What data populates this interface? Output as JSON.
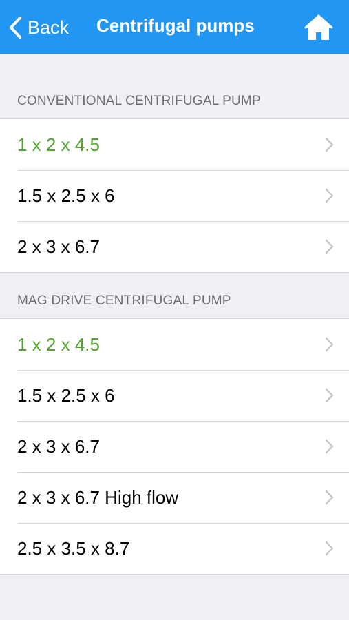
{
  "header": {
    "back_label": "Back",
    "title": "Centrifugal pumps",
    "home_icon": "home-icon",
    "back_icon": "chevron-left-icon",
    "background_color": "#2196f3"
  },
  "sections": [
    {
      "title": "CONVENTIONAL CENTRIFUGAL PUMP",
      "items": [
        {
          "label": "1 x 2 x 4.5",
          "highlighted": true
        },
        {
          "label": "1.5 x 2.5 x 6",
          "highlighted": false
        },
        {
          "label": "2 x 3 x 6.7",
          "highlighted": false
        }
      ]
    },
    {
      "title": "MAG DRIVE CENTRIFUGAL PUMP",
      "items": [
        {
          "label": "1 x 2 x 4.5",
          "highlighted": true
        },
        {
          "label": "1.5 x 2.5 x 6",
          "highlighted": false
        },
        {
          "label": "2 x 3 x 6.7",
          "highlighted": false
        },
        {
          "label": "2 x 3 x 6.7 High flow",
          "highlighted": false
        },
        {
          "label": "2.5 x 3.5 x 8.7",
          "highlighted": false
        }
      ]
    }
  ],
  "colors": {
    "highlight_text": "#55a630",
    "section_header_text": "#6d6d72",
    "page_background": "#efeff4"
  }
}
